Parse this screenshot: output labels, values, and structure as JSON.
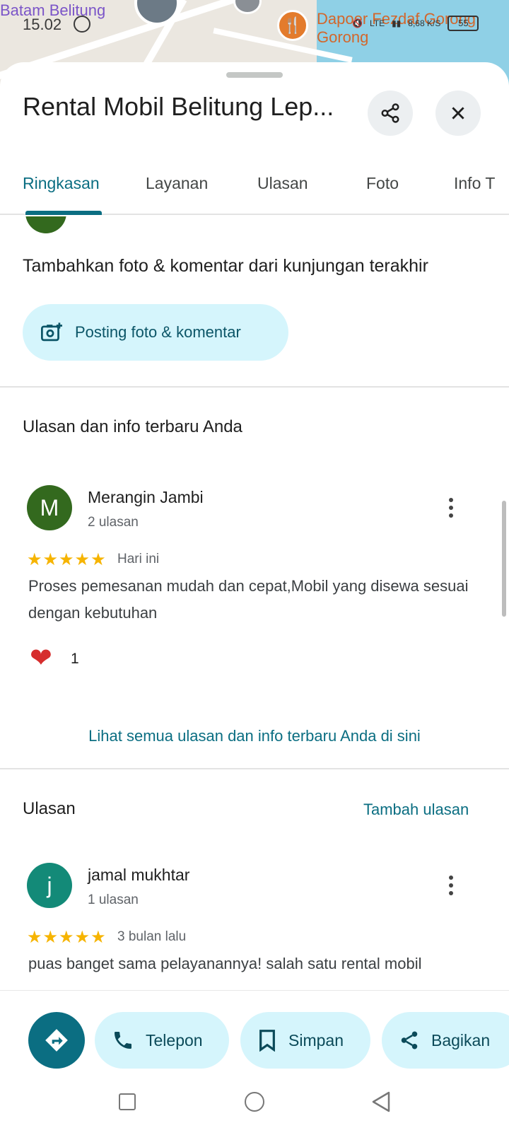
{
  "status_bar": {
    "time": "15.02",
    "network": "LTE",
    "speed": "8,68",
    "speed_unit": "K/S",
    "battery": "55"
  },
  "map": {
    "label_left": "Batam Belitung",
    "label_right": "Dapoer Fezdaf Gorong Gorong"
  },
  "sheet": {
    "title": "Rental Mobil Belitung Lep...",
    "share_icon": "share-icon",
    "close_icon": "close-icon"
  },
  "tabs": [
    {
      "label": "Ringkasan",
      "active": true
    },
    {
      "label": "Layanan",
      "active": false
    },
    {
      "label": "Ulasan",
      "active": false
    },
    {
      "label": "Foto",
      "active": false
    },
    {
      "label": "Info T",
      "active": false
    }
  ],
  "add_photo": {
    "heading": "Tambahkan foto & komentar dari kunjungan terakhir",
    "button_label": "Posting foto & komentar"
  },
  "your_reviews": {
    "title": "Ulasan dan info terbaru Anda",
    "review": {
      "avatar_letter": "M",
      "avatar_color": "#33691e",
      "name": "Merangin Jambi",
      "count": "2 ulasan",
      "rating": 5,
      "when": "Hari ini",
      "text": "Proses pemesanan mudah dan cepat,Mobil yang disewa sesuai dengan kebutuhan",
      "reaction_count": "1"
    },
    "see_all": "Lihat semua ulasan dan info terbaru Anda di sini"
  },
  "reviews": {
    "title": "Ulasan",
    "add_label": "Tambah ulasan",
    "items": [
      {
        "avatar_letter": "j",
        "avatar_color": "#138a78",
        "name": "jamal mukhtar",
        "count": "1 ulasan",
        "rating": 5,
        "when": "3 bulan lalu",
        "text": "puas banget sama pelayanannya! salah satu rental mobil"
      }
    ]
  },
  "actions": {
    "directions_icon": "directions-icon",
    "phone_label": "Telepon",
    "save_label": "Simpan",
    "share_label": "Bagikan"
  },
  "colors": {
    "accent": "#0b6e82",
    "pill_bg": "#d5f5fc",
    "star": "#f6b400"
  }
}
